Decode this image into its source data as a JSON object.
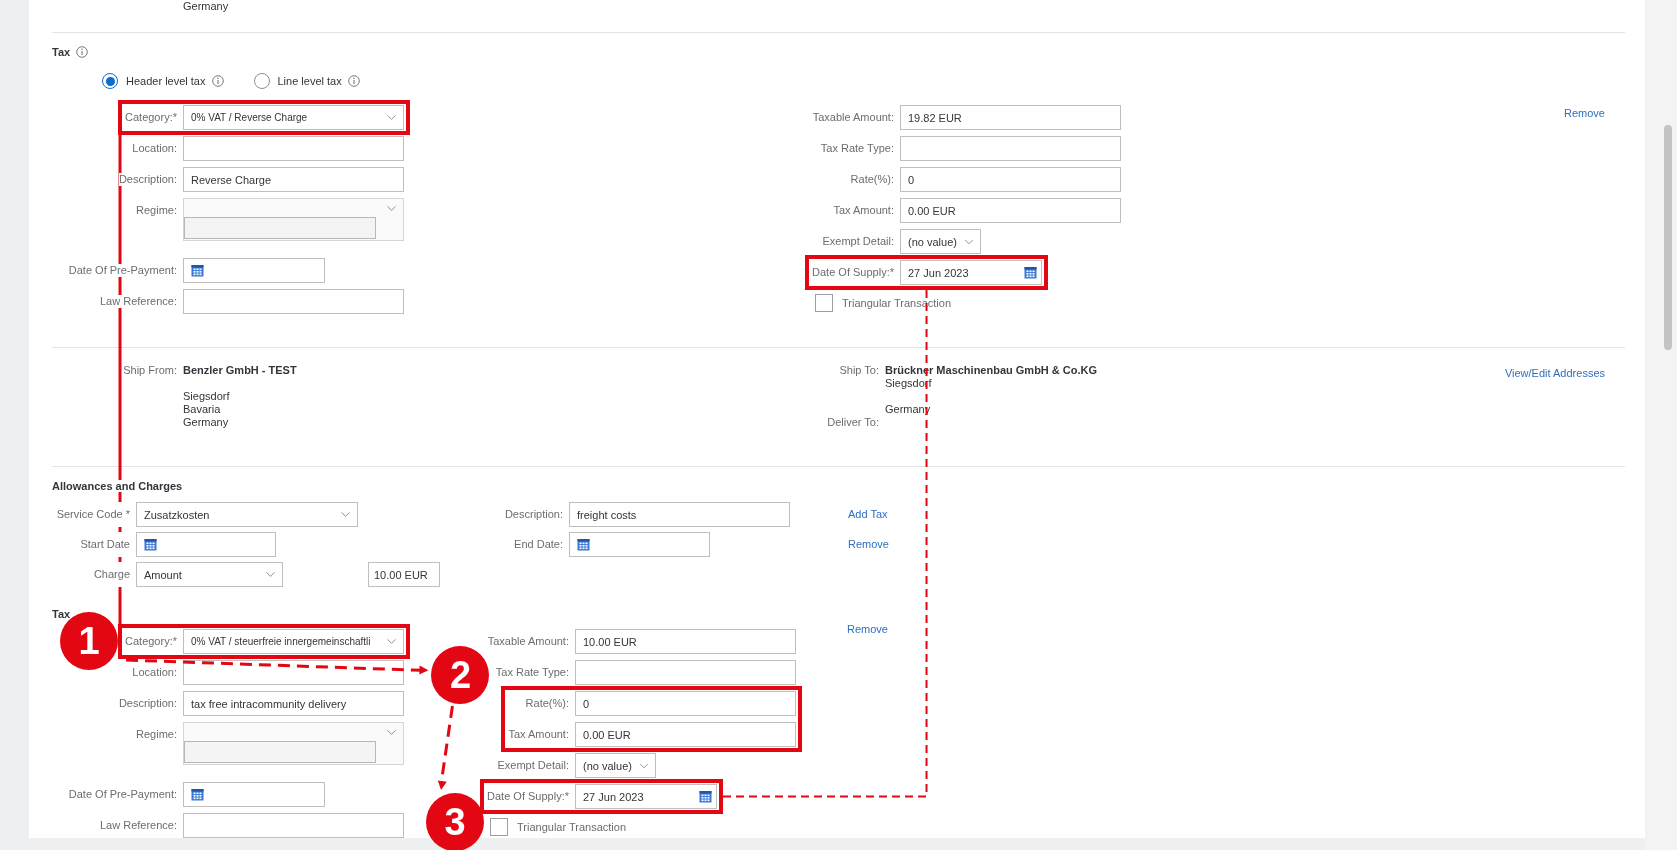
{
  "top_address": {
    "line": "Germany"
  },
  "header_tax": {
    "title": "Tax",
    "levels": [
      {
        "label": "Header level tax",
        "selected": true
      },
      {
        "label": "Line level tax",
        "selected": false
      }
    ],
    "left_fields": [
      {
        "label": "Category:*",
        "kind": "select",
        "value": "0% VAT / Reverse Charge",
        "highlighted": true
      },
      {
        "label": "Location:",
        "kind": "text",
        "highlighted": false
      },
      {
        "label": "Description:",
        "kind": "text",
        "value": "Reverse Charge",
        "highlighted": false
      },
      {
        "label": "Regime:",
        "kind": "regime",
        "highlighted": false
      },
      {
        "label": "Date Of Pre-Payment:",
        "kind": "date",
        "highlighted": false
      },
      {
        "label": "Law Reference:",
        "kind": "text",
        "highlighted": false
      }
    ],
    "right_fields": [
      {
        "label": "Taxable Amount:",
        "kind": "text",
        "value": "19.82 EUR",
        "highlighted": false
      },
      {
        "label": "Tax Rate Type:",
        "kind": "text",
        "highlighted": false
      },
      {
        "label": "Rate(%):",
        "kind": "text",
        "value": "0",
        "highlighted": false
      },
      {
        "label": "Tax Amount:",
        "kind": "text",
        "value": "0.00 EUR",
        "highlighted": false
      },
      {
        "label": "Exempt Detail:",
        "kind": "small-select",
        "value": "(no value)",
        "highlighted": false
      },
      {
        "label": "Date Of Supply:*",
        "kind": "date",
        "value": "27 Jun 2023",
        "highlighted": true
      }
    ],
    "triangular": {
      "label": "Triangular Transaction",
      "checked": false
    },
    "remove": "Remove"
  },
  "shipping": {
    "ship_from": {
      "label": "Ship From:",
      "name": "Benzler GmbH - TEST",
      "lines": [
        "Siegsdorf",
        "Bavaria",
        "Germany"
      ]
    },
    "ship_to": {
      "label": "Ship To:",
      "name": "Brückner Maschinenbau GmbH & Co.KG",
      "lines": [
        "Siegsdorf",
        "Germany"
      ]
    },
    "deliver_to": {
      "label": "Deliver To:"
    },
    "link": "View/Edit Addresses"
  },
  "allowances": {
    "title": "Allowances and Charges",
    "service_code": {
      "label": "Service Code *",
      "value": "Zusatzkosten"
    },
    "description": {
      "label": "Description:",
      "value": "freight costs"
    },
    "add_tax": "Add Tax",
    "start_date": {
      "label": "Start Date"
    },
    "end_date": {
      "label": "End Date:"
    },
    "remove": "Remove",
    "charge": {
      "label": "Charge",
      "value": "Amount",
      "amount": "10.00 EUR"
    }
  },
  "line_tax": {
    "title": "Tax",
    "left_fields": [
      {
        "label": "Category:*",
        "kind": "select",
        "value": "0% VAT / steuerfreie innergemeinschaftli",
        "highlighted": true,
        "marker": {
          "number": "1"
        }
      },
      {
        "label": "Location:",
        "kind": "text",
        "highlighted": false
      },
      {
        "label": "Description:",
        "kind": "text",
        "value": "tax free intracommunity delivery",
        "highlighted": false
      },
      {
        "label": "Regime:",
        "kind": "regime",
        "highlighted": false
      },
      {
        "label": "Date Of Pre-Payment:",
        "kind": "date",
        "highlighted": false
      },
      {
        "label": "Law Reference:",
        "kind": "text",
        "highlighted": false
      }
    ],
    "right_fields": [
      {
        "label": "Taxable Amount:",
        "kind": "text",
        "value": "10.00 EUR",
        "highlighted": false
      },
      {
        "label": "Tax Rate Type:",
        "kind": "text",
        "highlighted": false
      },
      {
        "label": "Rate(%):",
        "kind": "text",
        "value": "0",
        "highlighted": true,
        "marker": {
          "number": "2"
        }
      },
      {
        "label": "Tax Amount:",
        "kind": "text",
        "value": "0.00 EUR",
        "highlighted": true
      },
      {
        "label": "Exempt Detail:",
        "kind": "small-select",
        "value": "(no value)",
        "highlighted": false
      },
      {
        "label": "Date Of Supply:*",
        "kind": "date",
        "value": "27 Jun 2023",
        "highlighted": true,
        "marker": {
          "number": "3"
        }
      }
    ],
    "triangular": {
      "label": "Triangular Transaction",
      "checked": false
    },
    "remove": "Remove"
  }
}
